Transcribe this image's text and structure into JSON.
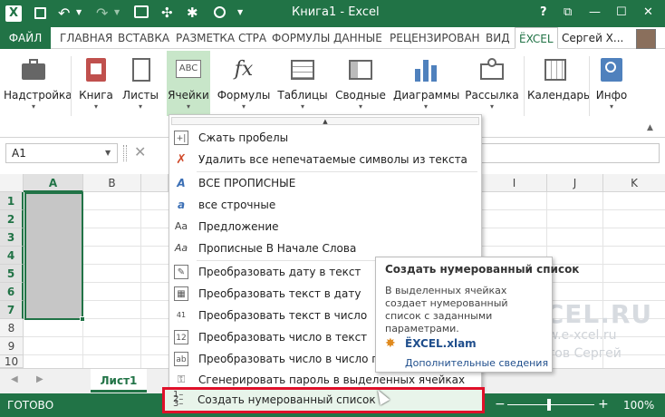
{
  "window": {
    "title": "Книга1 - Excel",
    "help": "?",
    "controls": {
      "restore": "⧉",
      "minimize": "—",
      "maximize": "☐",
      "close": "✕"
    }
  },
  "ribbon_tabs": [
    "ФАЙЛ",
    "ГЛАВНАЯ",
    "ВСТАВКА",
    "РАЗМЕТКА СТРА",
    "ФОРМУЛЫ",
    "ДАННЫЕ",
    "РЕЦЕНЗИРОВАН",
    "ВИД",
    "ЁXCEL"
  ],
  "user": {
    "name": "Сергей Х..."
  },
  "ribbon_buttons": [
    "Надстройка",
    "Книга",
    "Листы",
    "Ячейки",
    "Формулы",
    "Таблицы",
    "Сводные",
    "Диаграммы",
    "Рассылка",
    "Календарь",
    "Инфо"
  ],
  "formula_bar": {
    "name_box": "A1",
    "cancel": "✕"
  },
  "columns": [
    "A",
    "B",
    "I",
    "J",
    "K"
  ],
  "rows": [
    "1",
    "2",
    "3",
    "4",
    "5",
    "6",
    "7",
    "8",
    "9",
    "10"
  ],
  "selected_rows": 7,
  "menu": {
    "items": [
      {
        "label": "Сжать пробелы",
        "icon": "compress-spaces-icon"
      },
      {
        "label": "Удалить все непечатаемые символы из текста",
        "icon": "remove-symbols-icon"
      },
      {
        "label": "ВСЕ ПРОПИСНЫЕ",
        "icon": "uppercase-icon"
      },
      {
        "label": "все строчные",
        "icon": "lowercase-icon"
      },
      {
        "label": "Предложение",
        "icon": "sentence-case-icon",
        "glyph": "Aa"
      },
      {
        "label": "Прописные В Начале Слова",
        "icon": "title-case-icon",
        "glyph": "Aa"
      },
      {
        "label": "Преобразовать дату в текст",
        "icon": "date-to-text-icon"
      },
      {
        "label": "Преобразовать текст в дату",
        "icon": "text-to-date-icon"
      },
      {
        "label": "Преобразовать текст в число",
        "icon": "text-to-number-icon",
        "glyph": "41"
      },
      {
        "label": "Преобразовать число в текст",
        "icon": "number-to-text-icon"
      },
      {
        "label": "Преобразовать число в число прописью",
        "icon": "number-to-words-icon"
      },
      {
        "label": "Сгенерировать пароль в выделенных ячейках",
        "icon": "password-icon"
      },
      {
        "label": "Создать нумерованный список",
        "icon": "numbered-list-icon"
      }
    ]
  },
  "tooltip": {
    "title": "Создать нумерованный список",
    "body": "В выделенных ячейках создает нумерованный список с заданными параметрами.",
    "file": "ЁXCEL.xlam",
    "link": "Дополнительные сведения"
  },
  "watermark": {
    "brand": "ЁXCEL.RU",
    "url": "www.e-xcel.ru",
    "author": "Хвостов Сергей"
  },
  "sheet": {
    "tab": "Лист1"
  },
  "status": {
    "ready": "ГОТОВО",
    "zoom": "100%",
    "minus": "−",
    "plus": "+"
  },
  "colors": {
    "excel_green": "#217346",
    "highlight": "#e8f4ea",
    "frame_red": "#e0102a"
  }
}
